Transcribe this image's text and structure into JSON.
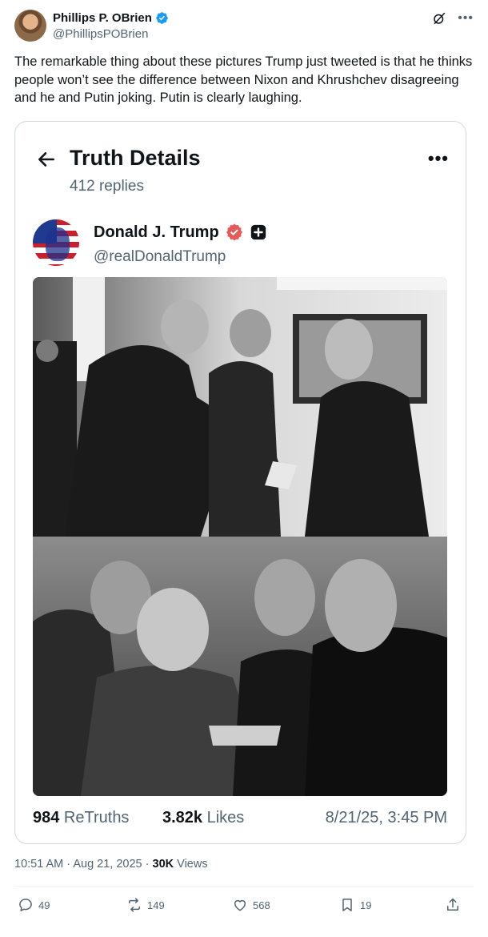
{
  "tweet": {
    "author": {
      "display_name": "Phillips P. OBrien",
      "handle": "@PhillipsPOBrien",
      "verified": true
    },
    "icons": [
      "grok-icon",
      "more-icon"
    ],
    "text": "The remarkable thing about these pictures Trump just tweeted is that he thinks people won’t see the difference between Nixon and Khrushchev disagreeing and he and Putin joking. Putin is clearly laughing.",
    "timestamp": "10:51 AM · Aug 21, 2025 · ",
    "views_count": "30K",
    "views_label": " Views"
  },
  "embedded_post": {
    "header_title": "Truth Details",
    "replies": "412 replies",
    "author": {
      "name": "Donald J. Trump",
      "handle": "@realDonaldTrump"
    },
    "stats": {
      "retruths_count": "984",
      "retruths_label": " ReTruths",
      "likes_count": "3.82k",
      "likes_label": " Likes",
      "date": "8/21/25, 3:45 PM"
    }
  },
  "actions": {
    "replies": "49",
    "reposts": "149",
    "likes": "568",
    "bookmarks": "19"
  },
  "colors": {
    "text": "#0f1419",
    "secondary": "#536471",
    "verified_blue": "#1d9bf0",
    "truth_verified": "#e25c5c"
  }
}
